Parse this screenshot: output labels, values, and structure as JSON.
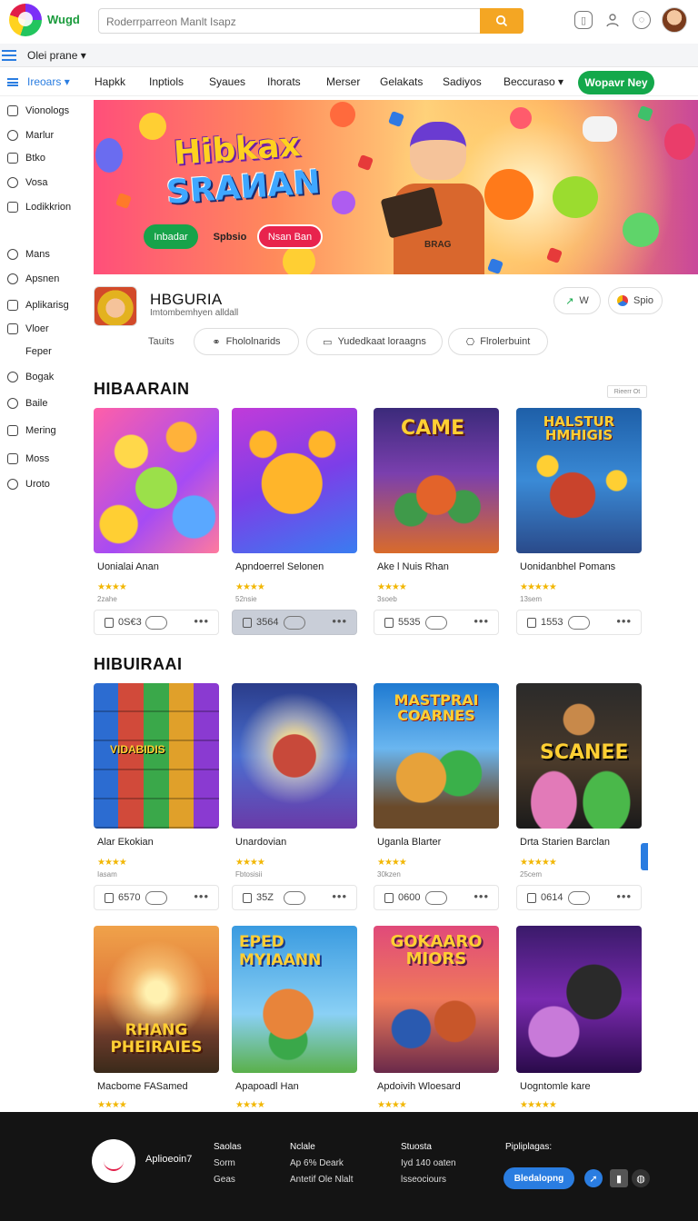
{
  "header": {
    "brand": "Wugd",
    "search_placeholder": "Roderrparreon Manlt Isapz",
    "icons": [
      "search-icon",
      "phone-icon",
      "user-icon",
      "chat-icon"
    ]
  },
  "subbar": {
    "label": "Olei prane"
  },
  "nav": {
    "categories_label": "Ireoars",
    "items": [
      "Hapkk",
      "Inptiols",
      "Syaues",
      "Ihorats",
      "Merser",
      "Gelakats",
      "Sadiyos",
      "Beccuraso"
    ],
    "cta": "Wopavr Ney"
  },
  "sidebar": {
    "group1": [
      {
        "label": "Vionologs",
        "icon": "grid-icon"
      },
      {
        "label": "Marlur",
        "icon": "globe-icon"
      },
      {
        "label": "Btko",
        "icon": "box-icon"
      },
      {
        "label": "Vosa",
        "icon": "search-icon"
      },
      {
        "label": "Lodikkrion",
        "icon": "list-icon"
      }
    ],
    "group2": [
      {
        "label": "Mans",
        "icon": "globe-icon"
      },
      {
        "label": "Apsnen",
        "icon": "user-icon"
      },
      {
        "label": "Aplikarisg",
        "icon": "app-icon"
      },
      {
        "label": "Vloer",
        "icon": "doc-icon"
      },
      {
        "label": "Feper",
        "icon": ""
      },
      {
        "label": "Bogak",
        "icon": "pin-icon"
      },
      {
        "label": "Baile",
        "icon": "tag-icon"
      },
      {
        "label": "Mering",
        "icon": "calendar-icon"
      },
      {
        "label": "Moss",
        "icon": "mail-icon"
      },
      {
        "label": "Uroto",
        "icon": "play-icon"
      }
    ]
  },
  "hero": {
    "title_line1": "Hibkax",
    "title_line2": "SRAИAN",
    "btn_primary": "Inbadar",
    "btn_secondary": "Spbsio",
    "btn_tertiary": "Nsan Ban",
    "shirt_text": "BRAG"
  },
  "app": {
    "name": "HBGURIA",
    "subtitle": "Imtombemhyen alldall",
    "btn_left": "W",
    "btn_right": "Spio",
    "tags_label": "Tauits",
    "tags": [
      "Fhololnarids",
      "Yudedkaat loraagns",
      "Flrolerbuint"
    ]
  },
  "section1": {
    "title": "HIBAARAIN",
    "more": "Rieerr Ot",
    "cards": [
      {
        "name": "Uonialai Anan",
        "meta": "2zahe",
        "count": "0S€3",
        "cover": "SMILEY EMOJI",
        "active": false
      },
      {
        "name": "Apndoerrel Selonen",
        "meta": "52nsie",
        "count": "3564",
        "cover": "",
        "active": true
      },
      {
        "name": "Ake l Nuis Rhan",
        "meta": "3soeb",
        "count": "5535",
        "cover": "CAME",
        "active": false
      },
      {
        "name": "Uonidanbhel Pomans",
        "meta": "13sem",
        "count": "1553",
        "cover": "HALSTUR HMHIGIS",
        "active": false
      }
    ]
  },
  "section2": {
    "title": "HIBUIRAAI",
    "cards": [
      {
        "name": "Alar Ekokian",
        "meta": "Iasam",
        "count": "6570",
        "cover": "VIDABIDIS"
      },
      {
        "name": "Unardovian",
        "meta": "Fbtosisii",
        "count": "35Z",
        "cover": ""
      },
      {
        "name": "Uganla Blarter",
        "meta": "30kzen",
        "count": "0600",
        "cover": "MASTPRAI COARNES"
      },
      {
        "name": "Drta Starien Barclan",
        "meta": "25cem",
        "count": "0614",
        "cover": "SCANEE"
      }
    ]
  },
  "section3": {
    "cards": [
      {
        "name": "Macbome FASamed",
        "cover": "RHANG PHEIRAIES"
      },
      {
        "name": "Apapoadl Han",
        "cover": "EPED MYIAANN"
      },
      {
        "name": "Apdoivih Wloesard",
        "cover": "GOKAARO MIORS"
      },
      {
        "name": "Uogntomle kare",
        "cover": ""
      }
    ]
  },
  "footer": {
    "brand": "Aplioeoin7",
    "col1": {
      "head": "Saolas",
      "items": [
        "Sorm",
        "Geas"
      ]
    },
    "col2": {
      "head": "Nclale",
      "items": [
        "Ap 6% Deark",
        "Antetif Ole Nlalt"
      ]
    },
    "col3": {
      "head": "Stuosta",
      "items": [
        "Iyd 140 oaten",
        "lsseociours"
      ]
    },
    "col4": {
      "head": "Pipliplagas:"
    },
    "cta": "Bledalopng"
  },
  "colors": {
    "accent_blue": "#2a7de1",
    "accent_green": "#14a84b",
    "search_orange": "#f4a623",
    "star_yellow": "#f2b705"
  }
}
